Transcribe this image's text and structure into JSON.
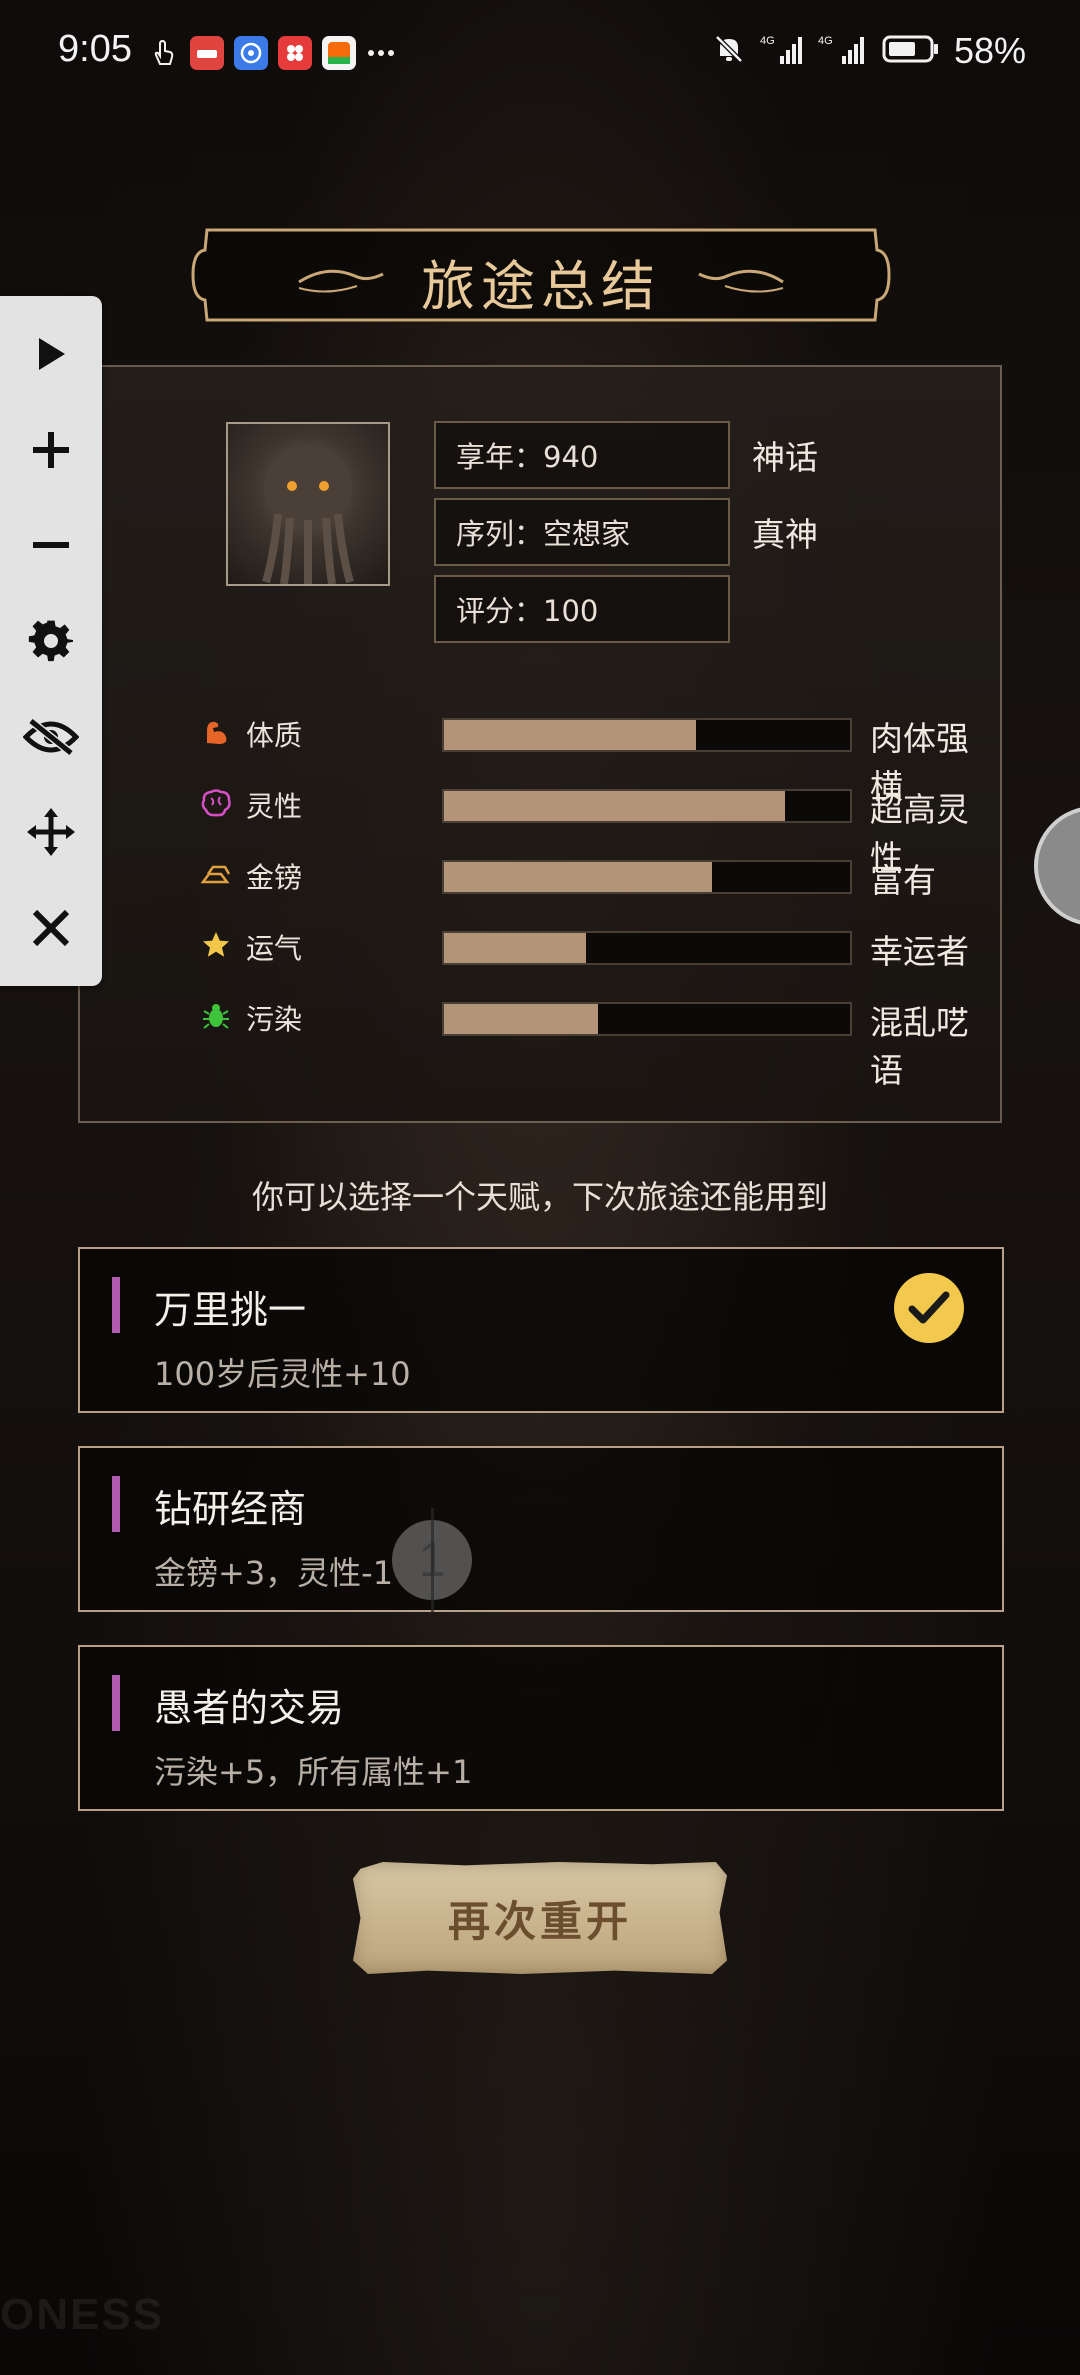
{
  "status_bar": {
    "time": "9:05",
    "battery": "58%",
    "app_icons": [
      "touch-icon",
      "huawei-app-icon",
      "browser-app-icon",
      "group-app-icon",
      "taobao-app-icon",
      "more-icon"
    ],
    "network": "4G"
  },
  "header": {
    "title": "旅途总结"
  },
  "toolbar": {
    "items": [
      "play-icon",
      "plus-icon",
      "minus-icon",
      "gear-icon",
      "eye-off-icon",
      "move-icon",
      "close-icon"
    ]
  },
  "summary": {
    "lifespan_label": "享年：940",
    "lifespan_tag": "神话",
    "sequence_label": "序列：空想家",
    "sequence_tag": "真神",
    "score_label": "评分：100",
    "attributes": [
      {
        "name": "体质",
        "level": 0.62,
        "desc": "肉体强横",
        "icon": "muscle-icon",
        "color": "#e8652a"
      },
      {
        "name": "灵性",
        "level": 0.84,
        "desc": "超高灵性",
        "icon": "brain-icon",
        "color": "#d64fc4"
      },
      {
        "name": "金镑",
        "level": 0.66,
        "desc": "富有",
        "icon": "gold-bars-icon",
        "color": "#e0a040"
      },
      {
        "name": "运气",
        "level": 0.35,
        "desc": "幸运者",
        "icon": "star-icon",
        "color": "#f2c84a"
      },
      {
        "name": "污染",
        "level": 0.38,
        "desc": "混乱呓语",
        "icon": "bug-icon",
        "color": "#3ec43a"
      }
    ]
  },
  "hint": "你可以选择一个天赋，下次旅途还能用到",
  "talents": [
    {
      "title": "万里挑一",
      "desc": "100岁后灵性+10",
      "selected": true
    },
    {
      "title": "钻研经商",
      "desc": "金镑+3，灵性-1",
      "selected": false
    },
    {
      "title": "愚者的交易",
      "desc": "污染+5，所有属性+1",
      "selected": false
    }
  ],
  "restart_label": "再次重开",
  "watermark": "ONESS",
  "cursor_digit": "1"
}
